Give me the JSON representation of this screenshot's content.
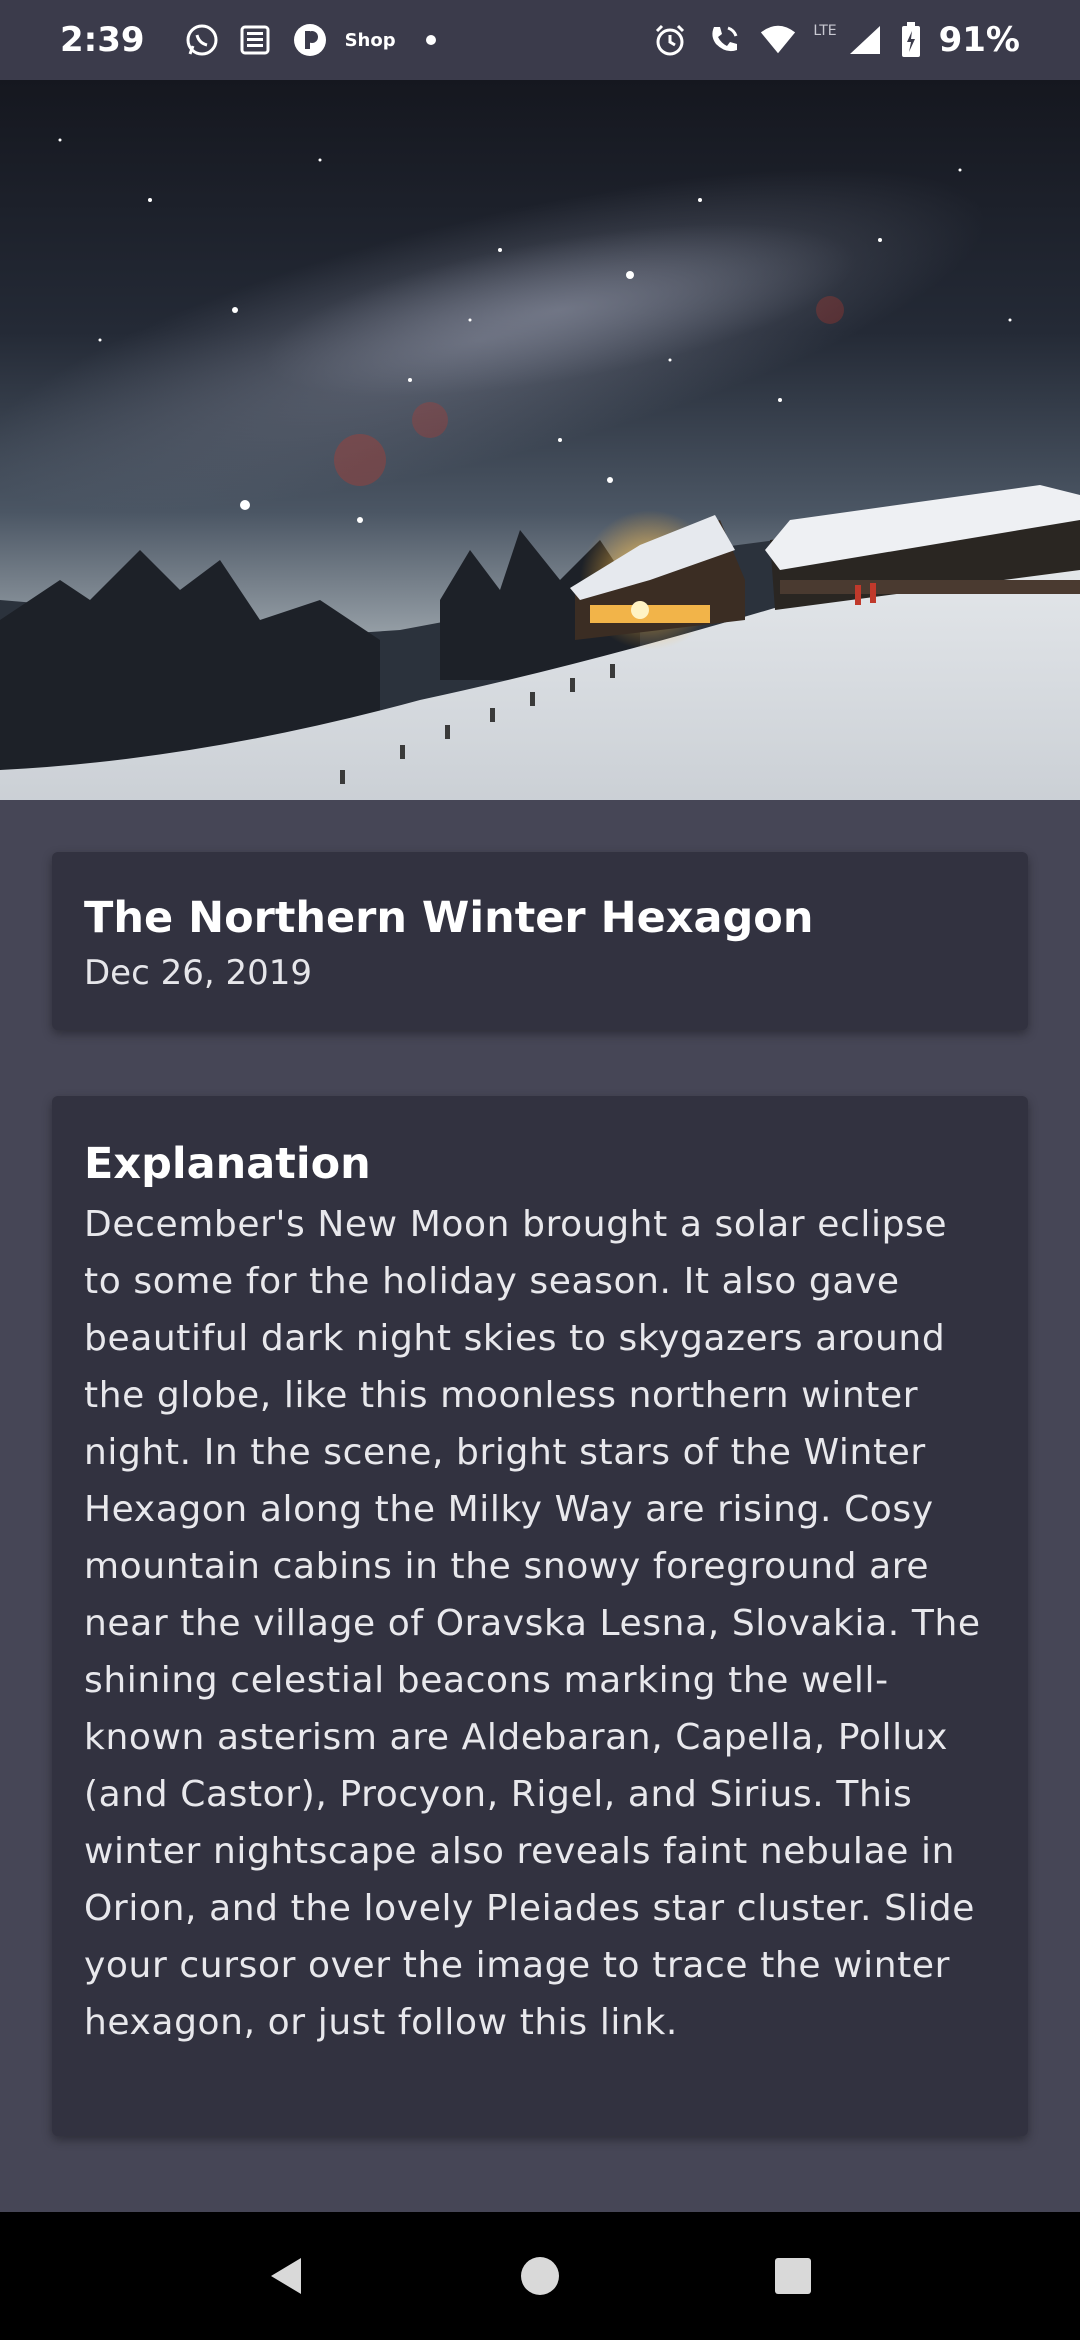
{
  "status_bar": {
    "time": "2:39",
    "shop_label": "Shop",
    "network": "LTE",
    "battery": "91%",
    "icons": [
      "whatsapp-icon",
      "news-icon",
      "p-app-icon",
      "alarm-icon",
      "wifi-call-icon",
      "wifi-icon",
      "signal-icon",
      "battery-icon"
    ]
  },
  "hero": {
    "icon": "night-sky-photo"
  },
  "apod": {
    "title": "The Northern Winter Hexagon",
    "date": "Dec 26, 2019",
    "explanation_heading": "Explanation",
    "explanation": "December's New Moon brought a solar eclipse to some for the holiday season. It also gave beautiful dark night skies to skygazers around the globe, like this moonless northern winter night. In the scene, bright stars of the Winter Hexagon along the Milky Way are rising. Cosy mountain cabins in the snowy foreground are near the village of Oravska Lesna, Slovakia. The shining celestial beacons marking the well-known asterism are Aldebaran, Capella, Pollux (and Castor), Procyon, Rigel, and Sirius. This winter nightscape also reveals faint nebulae in Orion, and the lovely Pleiades star cluster. Slide your cursor over the image to trace the winter hexagon, or just follow this link."
  },
  "nav": {
    "icons": [
      "back-icon",
      "home-icon",
      "recents-icon"
    ]
  },
  "colors": {
    "background": "#464656",
    "card": "#323240",
    "status_bar": "#3b3b4b",
    "nav_bar": "#000000"
  }
}
